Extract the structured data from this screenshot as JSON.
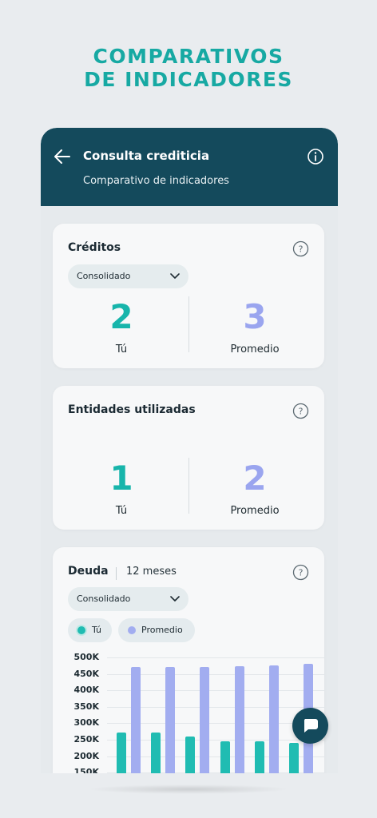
{
  "promo": {
    "line1": "COMPARATIVOS",
    "line2": "DE INDICADORES"
  },
  "header": {
    "title": "Consulta crediticia",
    "subtitle": "Comparativo de indicadores",
    "back_icon": "arrow-left-icon",
    "info_icon": "info-icon"
  },
  "creditos": {
    "title": "Créditos",
    "filter": "Consolidado",
    "you_value": "2",
    "you_label": "Tú",
    "avg_value": "3",
    "avg_label": "Promedio"
  },
  "entidades": {
    "title": "Entidades utilizadas",
    "you_value": "1",
    "you_label": "Tú",
    "avg_value": "2",
    "avg_label": "Promedio"
  },
  "deuda": {
    "title": "Deuda",
    "period": "12 meses",
    "filter": "Consolidado",
    "legend_you": "Tú",
    "legend_avg": "Promedio"
  },
  "colors": {
    "you": "#20bcb2",
    "avg": "#a2adf0",
    "header": "#144a5c",
    "accent": "#17a9a3"
  },
  "chart_data": {
    "type": "bar",
    "yticks": [
      "500K",
      "450K",
      "400K",
      "350K",
      "300K",
      "250K",
      "200K",
      "150K"
    ],
    "ylim": [
      150000,
      500000
    ],
    "series": [
      {
        "name": "Tú",
        "values": [
          272000,
          272000,
          260000,
          245000,
          245000,
          240000
        ]
      },
      {
        "name": "Promedio",
        "values": [
          470000,
          470000,
          472000,
          474000,
          475000,
          480000
        ]
      }
    ]
  }
}
